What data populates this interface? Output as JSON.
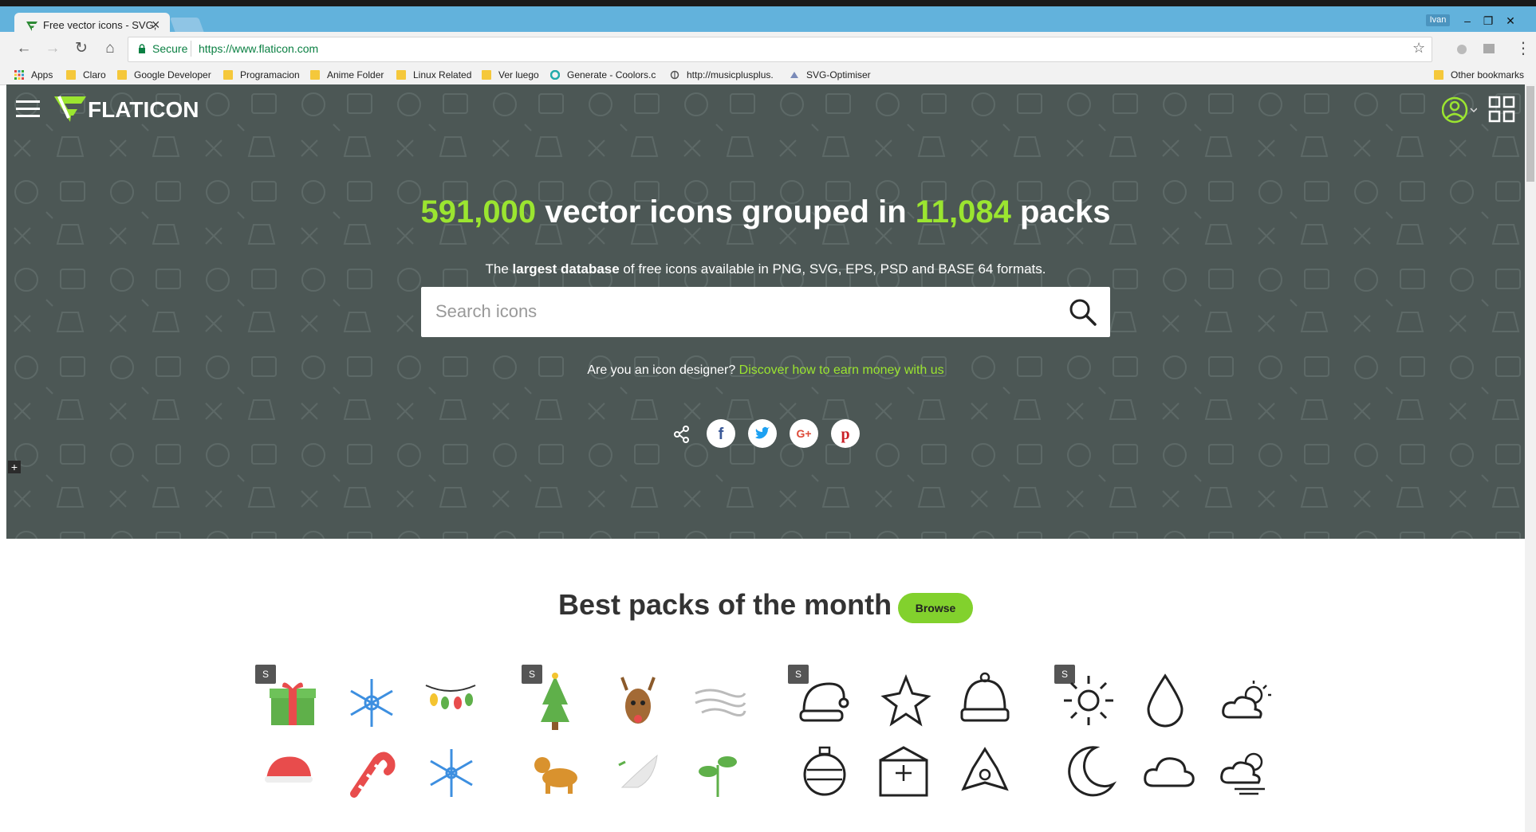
{
  "browser": {
    "tab_title": "Free vector icons - SVG,",
    "tab_close": "×",
    "user_badge": "Ivan",
    "secure_label": "Secure",
    "url": "https://www.flaticon.com",
    "window_controls": {
      "minimize": "–",
      "restore": "❐",
      "close": "✕"
    },
    "bookmarks": [
      {
        "label": "Apps",
        "icon": "apps-grid-icon"
      },
      {
        "label": "Claro",
        "icon": "folder-icon"
      },
      {
        "label": "Google Developer",
        "icon": "folder-icon"
      },
      {
        "label": "Programacion",
        "icon": "folder-icon"
      },
      {
        "label": "Anime Folder",
        "icon": "folder-icon"
      },
      {
        "label": "Linux Related",
        "icon": "folder-icon"
      },
      {
        "label": "Ver luego",
        "icon": "folder-icon"
      },
      {
        "label": "Generate - Coolors.c",
        "icon": "coolors-icon"
      },
      {
        "label": "http://musicplusplus.",
        "icon": "link-icon"
      },
      {
        "label": "SVG-Optimiser",
        "icon": "svg-optimiser-icon"
      }
    ],
    "other_bookmarks": "Other bookmarks"
  },
  "site": {
    "logo_text": "FLATICON",
    "headline": {
      "count": "591,000",
      "middle": " vector icons grouped in ",
      "packs": "11,084",
      "end": " packs"
    },
    "subline": {
      "before": "The ",
      "bold": "largest database",
      "after": " of free icons available in PNG, SVG, EPS, PSD and BASE 64 formats."
    },
    "search": {
      "placeholder": "Search icons",
      "value": ""
    },
    "designer": {
      "question": "Are you an icon designer? ",
      "link": "Discover how to earn money with us"
    },
    "social": [
      "share-icon",
      "facebook-icon",
      "twitter-icon",
      "google-plus-icon",
      "pinterest-icon"
    ],
    "plus_label": "+",
    "packs": {
      "title": "Best packs of the month",
      "browse": "Browse",
      "badge": "S"
    },
    "colors": {
      "hero_bg": "#4c5755",
      "accent": "#9be530",
      "browse_bg": "#82d12d"
    }
  }
}
